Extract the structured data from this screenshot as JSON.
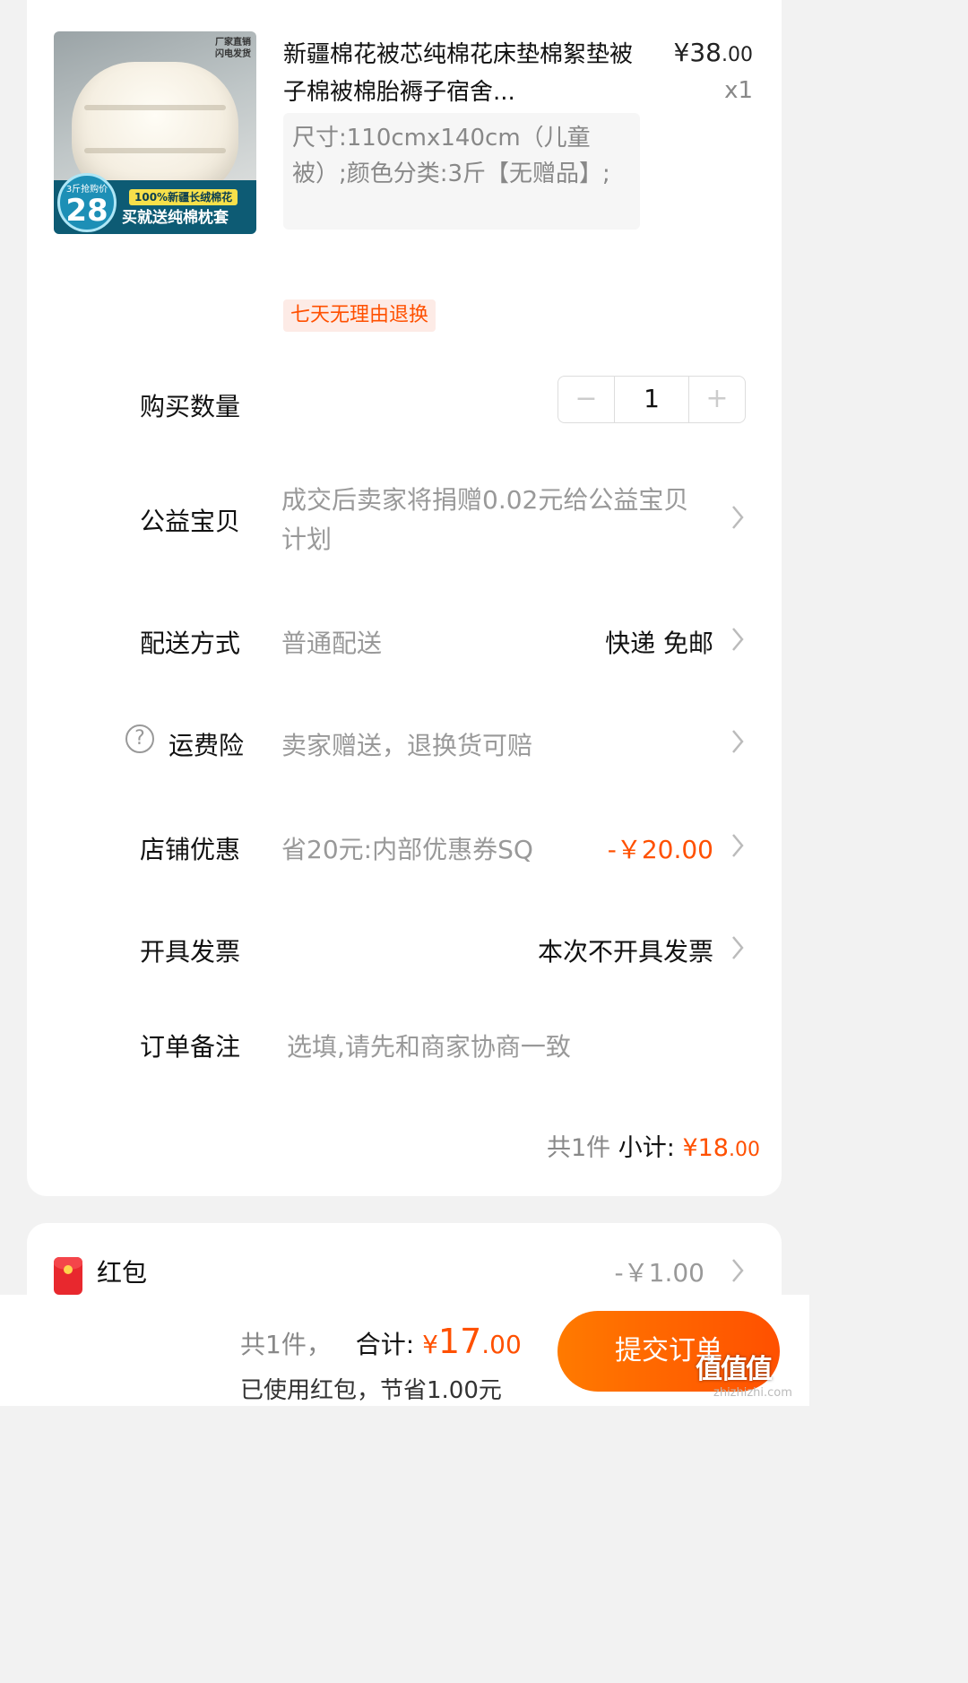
{
  "product": {
    "image_tag_line1": "厂家直销",
    "image_tag_line2": "闪电发货",
    "image_badge_small": "3斤抢购价",
    "image_badge_big": "28",
    "image_promo1": "100%新疆长绒棉花",
    "image_promo2": "买就送纯棉枕套",
    "title": "新疆棉花被芯纯棉花床垫棉絮垫被子棉被棉胎褥子宿舍...",
    "price_int": "¥38",
    "price_cents": ".00",
    "qty": "x1",
    "sku": "尺寸:110cmx140cm（儿童被）;颜色分类:3斤【无赠品】;",
    "return_tag": "七天无理由退换"
  },
  "rows": {
    "quantity": {
      "label": "购买数量",
      "minus": "−",
      "value": "1",
      "plus": "+"
    },
    "charity": {
      "label": "公益宝贝",
      "value": "成交后卖家将捐赠0.02元给公益宝贝计划"
    },
    "delivery": {
      "label": "配送方式",
      "value": "普通配送",
      "right": "快递 免邮"
    },
    "insurance": {
      "icon": "?",
      "label": "运费险",
      "value": "卖家赠送，退换货可赔"
    },
    "shop_discount": {
      "label": "店铺优惠",
      "value": "省20元:内部优惠券SQ",
      "right": "-￥20.00"
    },
    "invoice": {
      "label": "开具发票",
      "right": "本次不开具发票"
    },
    "note": {
      "label": "订单备注",
      "placeholder": "选填,请先和商家协商一致"
    }
  },
  "subtotal": {
    "count": "共1件",
    "label": "小计:",
    "amount_int": "¥18",
    "amount_cents": ".00"
  },
  "red_packet": {
    "label": "红包",
    "value": "-￥1.00"
  },
  "bottom": {
    "count": "共1件，",
    "label": "合计:",
    "currency": "¥",
    "amount_int": "17",
    "amount_cents": ".00",
    "saved": "已使用红包，节省1.00元",
    "submit": "提交订单",
    "watermark": "值值值",
    "watermark_site": "zhizhizhi.com"
  },
  "colors": {
    "accent": "#ff5000",
    "muted": "#999999",
    "background": "#f2f2f2"
  }
}
